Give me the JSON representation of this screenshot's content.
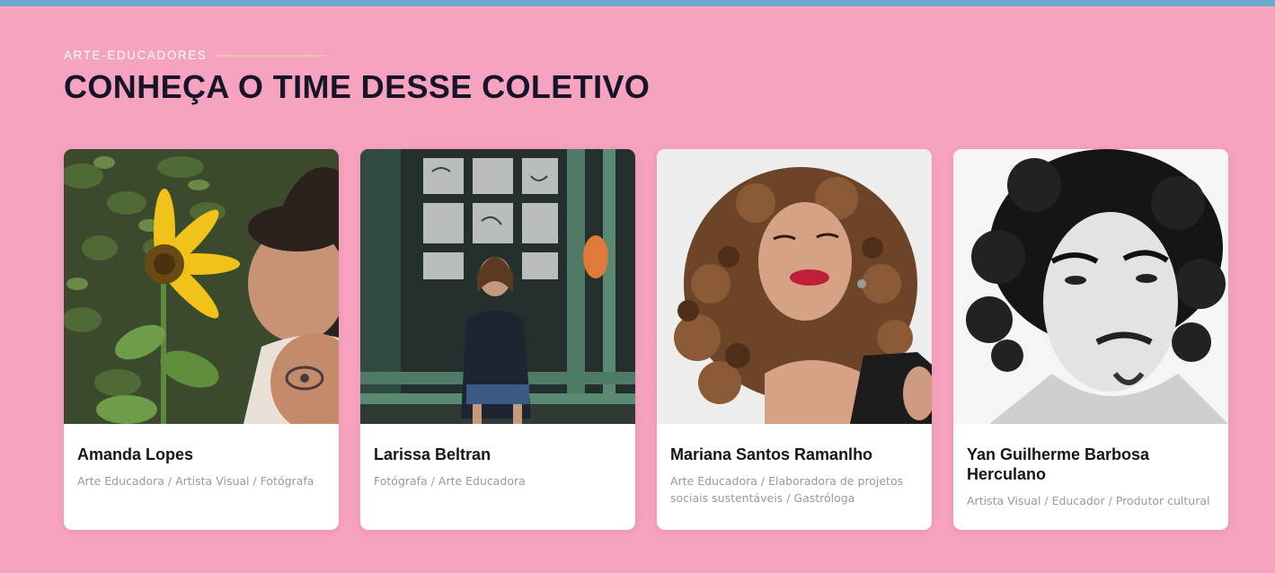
{
  "section": {
    "eyebrow": "ARTE-EDUCADORES",
    "title": "CONHEÇA O TIME DESSE COLETIVO"
  },
  "colors": {
    "background": "#f6a3bf",
    "top_bar": "#6aa8cf",
    "eyebrow_line": "#f3c0a6",
    "title": "#17142a",
    "card": "#ffffff",
    "role_text": "#9a9a9a"
  },
  "team": [
    {
      "name": "Amanda Lopes",
      "role": "Arte Educadora / Artista Visual / Fotógrafa"
    },
    {
      "name": "Larissa Beltran",
      "role": "Fotógrafa / Arte Educadora"
    },
    {
      "name": "Mariana Santos Ramanlho",
      "role": "Arte Educadora / Elaboradora de projetos sociais sustentáveis / Gastróloga"
    },
    {
      "name": "Yan Guilherme Barbosa Herculano",
      "role": "Artista Visual / Educador / Produtor cultural"
    }
  ]
}
